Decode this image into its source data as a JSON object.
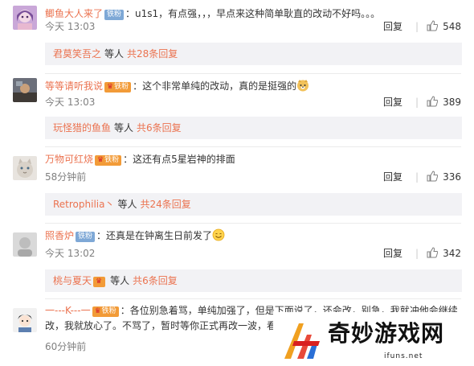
{
  "labels": {
    "reply": "回复",
    "etc": "等人"
  },
  "colors": {
    "username": "#eb7350",
    "badge": "#7ea8d6",
    "vip": "#f29b38",
    "subbox": "#f2f2f5"
  },
  "comments": [
    {
      "user": "鲫鱼大人来了",
      "badge": "铁粉",
      "text": "：u1s1，有点强，，，早点来这种简单耿直的改动不好吗。。。",
      "time": "今天 13:03",
      "likes": "548",
      "avatar": "anime-girl-avatar",
      "sub_user": "君莫笑吾之",
      "sub_count": "共28条回复"
    },
    {
      "user": "等等请听我说",
      "badge": "铁粉",
      "vip": true,
      "text": "：这个非常单纯的改动，真的是挺强的",
      "emoji": "doge-emoji",
      "time": "今天 13:03",
      "likes": "389",
      "avatar": "photo-avatar",
      "sub_user": "玩怪猎的鱼鱼",
      "sub_count": "共6条回复"
    },
    {
      "user": "万物可红烧",
      "badge": "铁粉",
      "vip": true,
      "text": "：这还有点5星岩神的排面",
      "time": "58分钟前",
      "likes": "336",
      "avatar": "cat-avatar",
      "sub_user": "Retrophilia丶",
      "sub_count": "共24条回复"
    },
    {
      "user": "照香炉",
      "badge": "铁粉",
      "text": "：还真是在钟离生日前发了",
      "emoji": "smile-emoji",
      "time": "今天 13:02",
      "likes": "342",
      "avatar": "gray-avatar",
      "sub_user": "桃与夏天",
      "sub_vip": true,
      "sub_count": "共6条回复"
    },
    {
      "user": "一---K---一",
      "badge": "铁粉",
      "vip": true,
      "text": "：各位别急着骂，单纯加强了，但是下面说了，还会改，别急，我就冲他会继续改，我就放心了。不骂了，暂时等你正式再改一波，看",
      "time": "60分钟前",
      "avatar": "anime-boy-avatar"
    }
  ],
  "watermark": {
    "name": "奇妙游戏网",
    "url": "ifuns.net"
  }
}
